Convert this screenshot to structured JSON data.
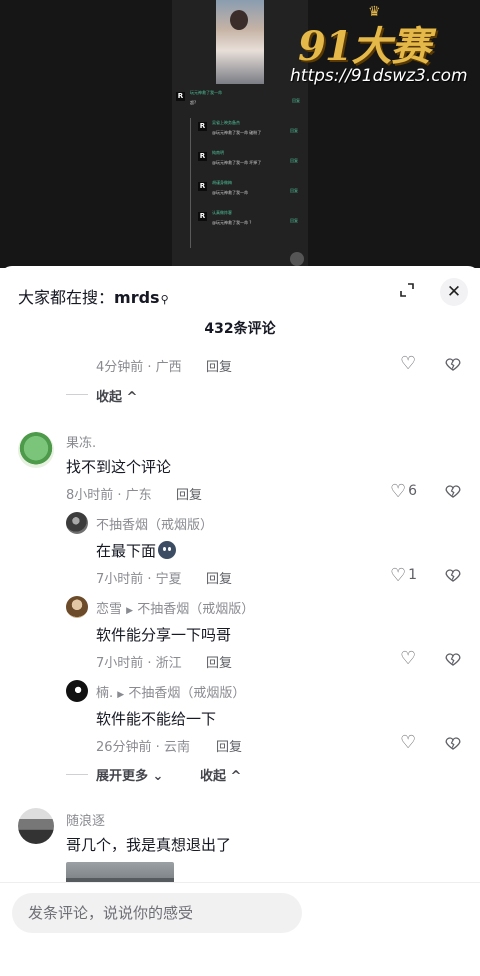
{
  "watermark": {
    "logo_text": "91大赛",
    "url": "https://91dswz3.com"
  },
  "mini_video": {
    "thread": [
      {
        "name": "玩元神救了我一命",
        "text": "超?",
        "reply": "回复"
      },
      {
        "name": "吴省上映务备杰",
        "text": "@玩元神救了我一命 破盼了",
        "reply": "回复"
      },
      {
        "name": "纯南明",
        "text": "@玩元神救了我一命 坏掉了",
        "reply": "回复"
      },
      {
        "name": "胡谨身做梅",
        "text": "@玩元神救了我一命",
        "reply": "回复"
      },
      {
        "name": "认真做炸客",
        "text": "@玩元神救了我一命 ?",
        "reply": "回复"
      }
    ]
  },
  "panel": {
    "search_prefix": "大家都在搜：",
    "search_keyword": "mrds",
    "comment_count": "432条评论"
  },
  "first_thread_tail": {
    "meta": "4分钟前 · 广西",
    "reply_label": "回复",
    "collapse_label": "收起"
  },
  "comments": [
    {
      "author": "果冻.",
      "text": "找不到这个评论",
      "meta": "8小时前 · 广东",
      "reply_label": "回复",
      "likes": "6",
      "replies": [
        {
          "author": "不抽香烟（戒烟版）",
          "reply_to": "",
          "text": "在最下面",
          "meta": "7小时前 · 宁夏",
          "reply_label": "回复",
          "likes": "1"
        },
        {
          "author": "恋雪",
          "reply_to": "不抽香烟（戒烟版）",
          "text": "软件能分享一下吗哥",
          "meta": "7小时前 · 浙江",
          "reply_label": "回复",
          "likes": ""
        },
        {
          "author": "楠.",
          "reply_to": "不抽香烟（戒烟版）",
          "text": "软件能不能给一下",
          "meta": "26分钟前 · 云南",
          "reply_label": "回复",
          "likes": ""
        }
      ],
      "expand_label": "展开更多",
      "collapse_label": "收起"
    },
    {
      "author": "随浪逐",
      "text": "哥几个，我是真想退出了"
    }
  ],
  "composer": {
    "placeholder": "发条评论，说说你的感受"
  },
  "icons": {
    "like": "heart-outline-icon",
    "dislike": "broken-heart-icon",
    "close": "close-icon",
    "expand": "expand-icon",
    "search": "search-icon"
  }
}
